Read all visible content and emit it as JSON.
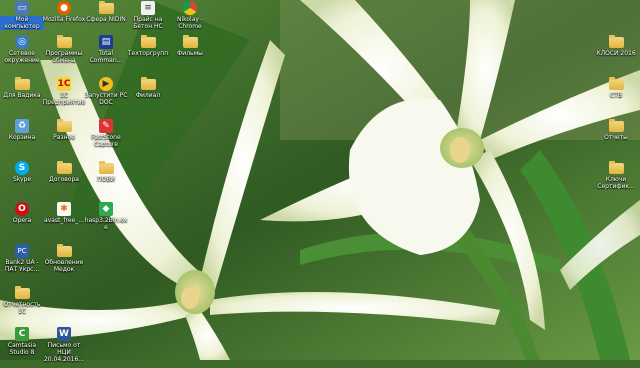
{
  "desktop": {
    "icons_left": [
      {
        "label": "Мой компьютер",
        "icon": "computer-icon"
      },
      {
        "label": "Mozilla Firefox",
        "icon": "firefox-icon"
      },
      {
        "label": "Сфера NIDIN",
        "icon": "folder-icon"
      },
      {
        "label": "Прайс на Бетон НС",
        "icon": "document-icon"
      },
      {
        "label": "Nikolay - Chrome",
        "icon": "chrome-icon"
      },
      {
        "label": "Сетевое окружение",
        "icon": "network-icon"
      },
      {
        "label": "Программы обмена",
        "icon": "folder-icon"
      },
      {
        "label": "Total Comman...",
        "icon": "total-commander-icon"
      },
      {
        "label": "Техторгрупп",
        "icon": "folder-icon"
      },
      {
        "label": "Фильмы",
        "icon": "folder-icon"
      },
      {
        "label": "Для Вадика",
        "icon": "folder-icon"
      },
      {
        "label": "1С Предприятие",
        "icon": "1c-icon"
      },
      {
        "label": "Запустити РС DOC",
        "icon": "run-icon"
      },
      {
        "label": "Филиал",
        "icon": "folder-icon"
      },
      {
        "label": "Корзина",
        "icon": "recycle-bin-icon"
      },
      {
        "label": "Разное",
        "icon": "folder-icon"
      },
      {
        "label": "FastStone Capture",
        "icon": "faststone-icon"
      },
      {
        "label": "Skype",
        "icon": "skype-icon"
      },
      {
        "label": "Договора",
        "icon": "folder-icon"
      },
      {
        "label": "ПОВИ",
        "icon": "folder-icon"
      },
      {
        "label": "Opera",
        "icon": "opera-icon"
      },
      {
        "label": "avast_free_...",
        "icon": "avast-icon"
      },
      {
        "label": "hasp3.2Bin.exe",
        "icon": "hasp-icon"
      },
      {
        "label": "Bank2 UA - ПАТ Укрс...",
        "icon": "bank-icon"
      },
      {
        "label": "Обновление Медок",
        "icon": "folder-icon"
      },
      {
        "label": "Отчетность 1С",
        "icon": "folder-icon"
      },
      {
        "label": "Camtasia Studio 8",
        "icon": "camtasia-icon"
      },
      {
        "label": "Письмо от НЦИ 20.04.2016...",
        "icon": "word-document-icon"
      }
    ],
    "icons_right": [
      {
        "label": "КЛОСИ 2016",
        "icon": "folder-icon"
      },
      {
        "label": "СТВ",
        "icon": "folder-icon"
      },
      {
        "label": "Отчеты",
        "icon": "folder-icon"
      },
      {
        "label": "Ключи Сертифик...",
        "icon": "folder-icon"
      }
    ]
  },
  "colors": {
    "folder": "#e8c25a",
    "selection": "#2a6fd0",
    "petal": "#f4f6e4",
    "leaf": "#3f7a2a"
  }
}
